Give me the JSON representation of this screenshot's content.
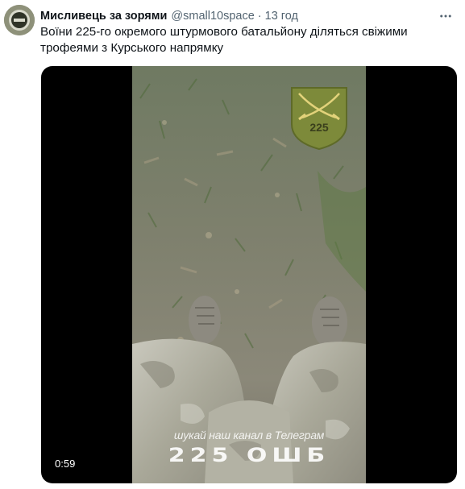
{
  "tweet": {
    "author_name": "Мисливець за зорями",
    "author_handle": "@small10space",
    "separator": "·",
    "time": "13 год",
    "text": "Воїни 225-го окремого штурмового батальйону діляться свіжими трофеями з Курського напрямку"
  },
  "media": {
    "duration": "0:59",
    "patch_number": "225",
    "overlay_line1": "шукай наш канал в Телеграм",
    "overlay_line2": "225 ОШБ"
  },
  "icons": {
    "avatar": "avatar-icon",
    "more": "more-horizontal-icon",
    "patch": "unit-patch-sabres-icon"
  },
  "colors": {
    "text": "#0f1419",
    "secondary": "#536471",
    "media_bg": "#000000",
    "patch_green": "#7d8a3a"
  }
}
